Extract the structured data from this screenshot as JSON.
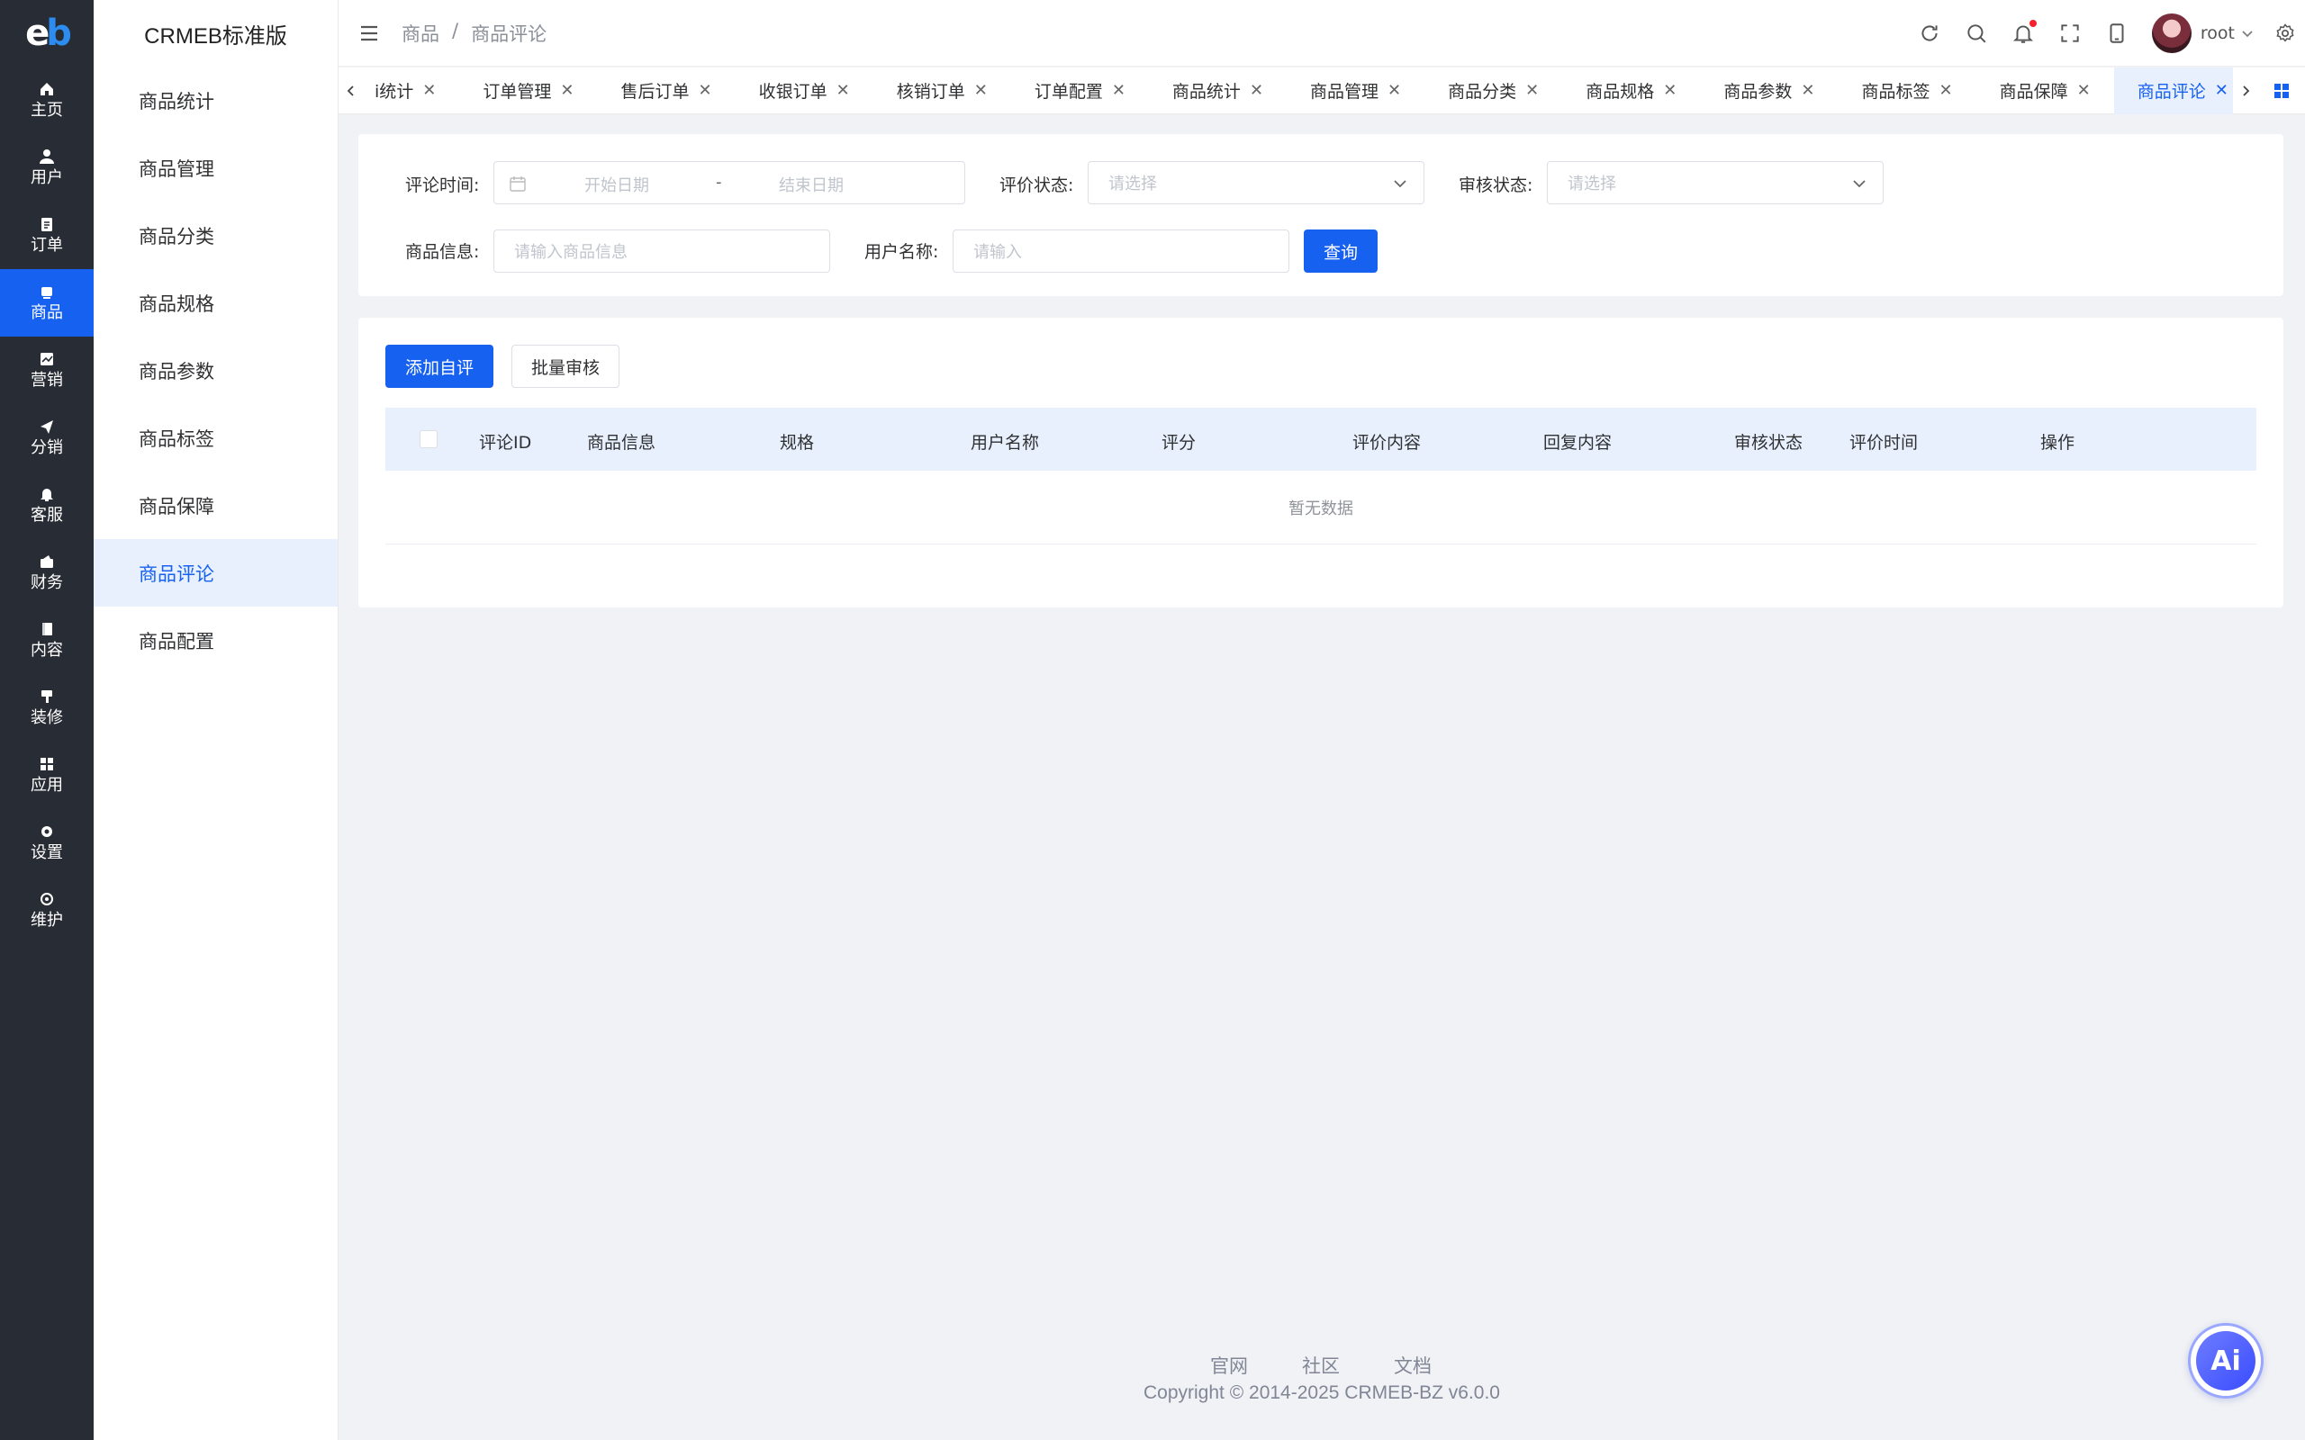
{
  "app": {
    "logo_text": "eb",
    "brand": "CRMEB标准版"
  },
  "rail": [
    {
      "label": "主页",
      "icon": "home-icon"
    },
    {
      "label": "用户",
      "icon": "user-icon"
    },
    {
      "label": "订单",
      "icon": "order-icon"
    },
    {
      "label": "商品",
      "icon": "product-icon",
      "active": true
    },
    {
      "label": "营销",
      "icon": "marketing-icon"
    },
    {
      "label": "分销",
      "icon": "distribution-icon"
    },
    {
      "label": "客服",
      "icon": "bell-icon"
    },
    {
      "label": "财务",
      "icon": "finance-icon"
    },
    {
      "label": "内容",
      "icon": "book-icon"
    },
    {
      "label": "装修",
      "icon": "decorate-icon"
    },
    {
      "label": "应用",
      "icon": "apps-icon"
    },
    {
      "label": "设置",
      "icon": "gear-icon"
    },
    {
      "label": "维护",
      "icon": "maintain-icon"
    }
  ],
  "sidebar": {
    "items": [
      {
        "label": "商品统计"
      },
      {
        "label": "商品管理"
      },
      {
        "label": "商品分类"
      },
      {
        "label": "商品规格"
      },
      {
        "label": "商品参数"
      },
      {
        "label": "商品标签"
      },
      {
        "label": "商品保障"
      },
      {
        "label": "商品评论",
        "active": true
      },
      {
        "label": "商品配置"
      }
    ]
  },
  "header": {
    "breadcrumb": [
      "商品",
      "/",
      "商品评论"
    ],
    "user": "root"
  },
  "tabs": [
    {
      "label": "i统计"
    },
    {
      "label": "订单管理"
    },
    {
      "label": "售后订单"
    },
    {
      "label": "收银订单"
    },
    {
      "label": "核销订单"
    },
    {
      "label": "订单配置"
    },
    {
      "label": "商品统计"
    },
    {
      "label": "商品管理"
    },
    {
      "label": "商品分类"
    },
    {
      "label": "商品规格"
    },
    {
      "label": "商品参数"
    },
    {
      "label": "商品标签"
    },
    {
      "label": "商品保障"
    },
    {
      "label": "商品评论",
      "active": true
    }
  ],
  "filters": {
    "comment_time_label": "评论时间:",
    "start_date_placeholder": "开始日期",
    "date_separator": "-",
    "end_date_placeholder": "结束日期",
    "comment_status_label": "评价状态:",
    "comment_status_placeholder": "请选择",
    "audit_status_label": "审核状态:",
    "audit_status_placeholder": "请选择",
    "product_info_label": "商品信息:",
    "product_info_placeholder": "请输入商品信息",
    "username_label": "用户名称:",
    "username_placeholder": "请输入",
    "query_button": "查询"
  },
  "table": {
    "add_button": "添加自评",
    "batch_button": "批量审核",
    "columns": [
      "评论ID",
      "商品信息",
      "规格",
      "用户名称",
      "评分",
      "评价内容",
      "回复内容",
      "审核状态",
      "评价时间",
      "操作"
    ],
    "empty_text": "暂无数据"
  },
  "footer": {
    "links": [
      "官网",
      "社区",
      "文档"
    ],
    "copyright": "Copyright © 2014-2025 CRMEB-BZ v6.0.0"
  },
  "ai_badge": "Ai",
  "colors": {
    "primary": "#1761f0",
    "rail_bg": "#282c34",
    "active_light": "#e8f0fe"
  }
}
